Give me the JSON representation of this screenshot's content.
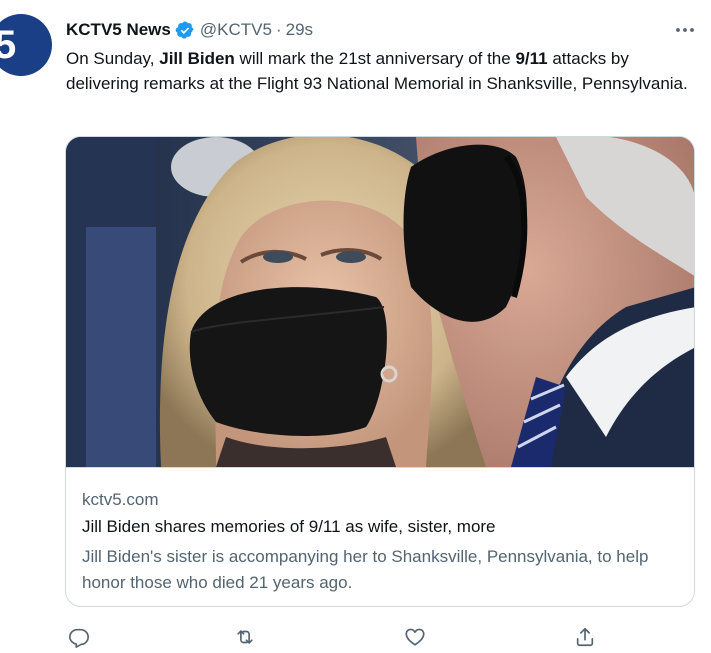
{
  "tweet": {
    "author": {
      "name": "KCTV5 News",
      "handle": "@KCTV5",
      "time": "29s",
      "separator": "·",
      "avatar_text": "5"
    },
    "text": {
      "part1": "On Sunday, ",
      "bold1": "Jill Biden",
      "part2": " will mark the 21st anniversary of the ",
      "bold2": "9/11",
      "part3": " attacks by delivering remarks at the Flight 93 National Memorial in Shanksville, Pennsylvania."
    },
    "card": {
      "domain": "kctv5.com",
      "title": "Jill Biden shares memories of 9/11 as wife, sister, more",
      "description": "Jill Biden's sister is accompanying her to Shanksville, Pennsylvania, to help honor those who died 21 years ago."
    },
    "actions": {
      "reply_icon": "reply-icon",
      "retweet_icon": "retweet-icon",
      "like_icon": "heart-icon",
      "share_icon": "share-icon"
    },
    "colors": {
      "text": "#0f1419",
      "secondary": "#536471",
      "verified": "#1d9bf0",
      "border": "#cfd9de",
      "avatar_bg": "#1b3f86"
    }
  }
}
